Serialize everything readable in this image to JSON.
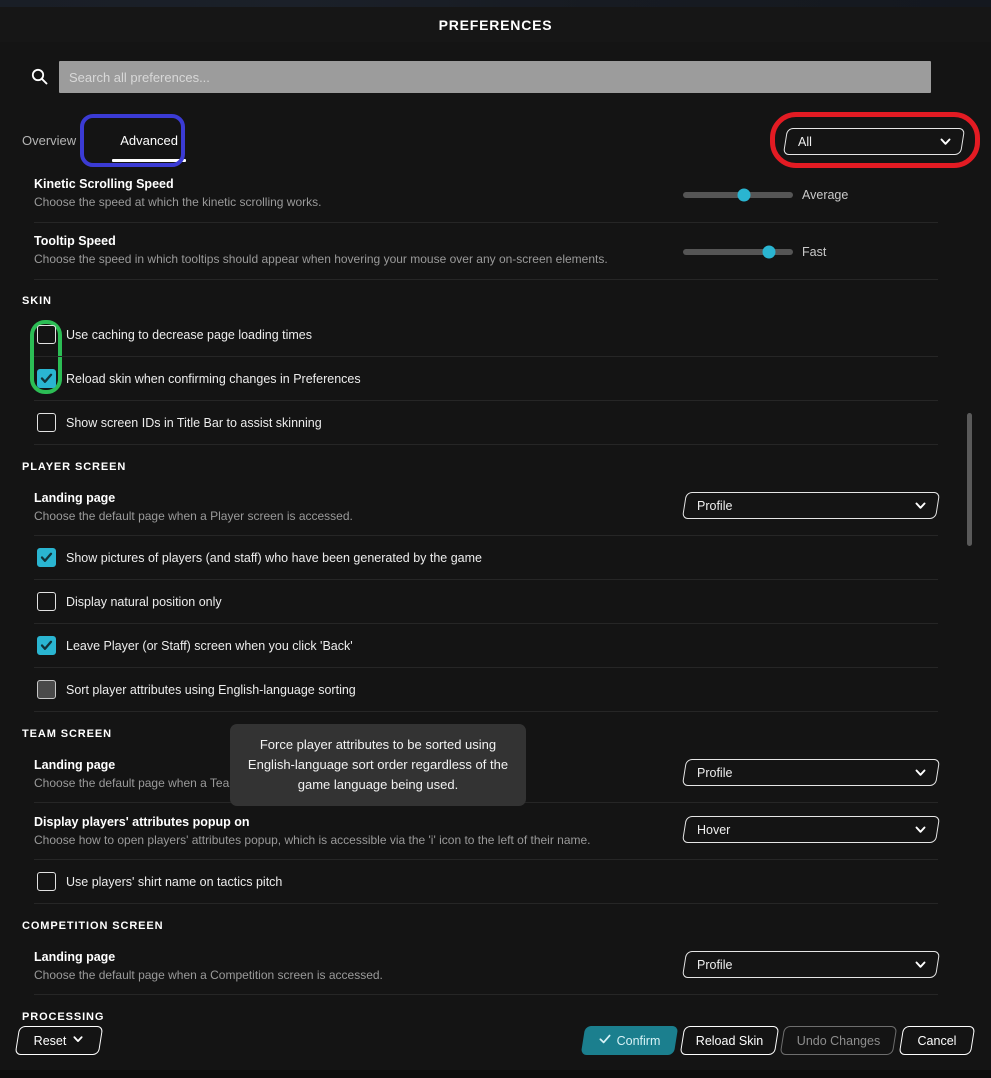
{
  "window": {
    "title": "PREFERENCES"
  },
  "search": {
    "placeholder": "Search all preferences...",
    "value": "",
    "icon": "search-icon"
  },
  "tabs": [
    {
      "label": "Overview",
      "active": false
    },
    {
      "label": "Advanced",
      "active": true
    }
  ],
  "filter": {
    "label": "All",
    "icon": "chevron-down-icon"
  },
  "settings": [
    {
      "name": "Kinetic Scrolling Speed",
      "desc": "Choose the speed at which the kinetic scrolling works.",
      "control": "slider",
      "value": "Average",
      "percent": 55
    },
    {
      "name": "Tooltip Speed",
      "desc": "Choose the speed in which tooltips should appear when hovering your mouse over any on-screen elements.",
      "control": "slider",
      "value": "Fast",
      "percent": 78
    }
  ],
  "sections": {
    "skin": {
      "heading": "SKIN",
      "checkboxes": [
        {
          "label": "Use caching to decrease page loading times",
          "checked": false,
          "hover": false
        },
        {
          "label": "Reload skin when confirming changes in Preferences",
          "checked": true,
          "hover": false
        },
        {
          "label": "Show screen IDs in Title Bar to assist skinning",
          "checked": false,
          "hover": false
        }
      ]
    },
    "player_screen": {
      "heading": "PLAYER SCREEN",
      "landing": {
        "name": "Landing page",
        "desc": "Choose the default page when a Player screen is accessed.",
        "value": "Profile"
      },
      "checkboxes": [
        {
          "label": "Show pictures of players (and staff) who have been generated by the game",
          "checked": true,
          "hover": false
        },
        {
          "label": "Display natural position only",
          "checked": false,
          "hover": false
        },
        {
          "label": "Leave Player (or Staff) screen when you click 'Back'",
          "checked": true,
          "hover": false
        },
        {
          "label": "Sort player attributes using English-language sorting",
          "checked": false,
          "hover": true
        }
      ]
    },
    "team_screen": {
      "heading": "TEAM SCREEN",
      "landing": {
        "name": "Landing page",
        "desc": "Choose the default page when a Team screen is accessed.",
        "value": "Profile"
      },
      "popup": {
        "name": "Display players' attributes popup on",
        "desc": "Choose how to open players' attributes popup, which is accessible via the 'i' icon to the left of their name.",
        "value": "Hover"
      },
      "checkboxes": [
        {
          "label": "Use players' shirt name on tactics pitch",
          "checked": false,
          "hover": false
        }
      ]
    },
    "competition_screen": {
      "heading": "COMPETITION SCREEN",
      "landing": {
        "name": "Landing page",
        "desc": "Choose the default page when a Competition screen is accessed.",
        "value": "Profile"
      }
    },
    "processing": {
      "heading": "PROCESSING"
    }
  },
  "tooltip": {
    "text": "Force player attributes to be sorted using English-language sort order regardless of the game language being used."
  },
  "buttons": {
    "reset": "Reset",
    "confirm": "Confirm",
    "reload_skin": "Reload Skin",
    "undo_changes": "Undo Changes",
    "cancel": "Cancel"
  },
  "highlights": {
    "blue": "#3b3bd4",
    "red": "#e31b23",
    "green": "#2cbd55"
  },
  "colors": {
    "accent": "#2ab5d1",
    "confirm": "#1b7f8e",
    "background": "#141414"
  }
}
